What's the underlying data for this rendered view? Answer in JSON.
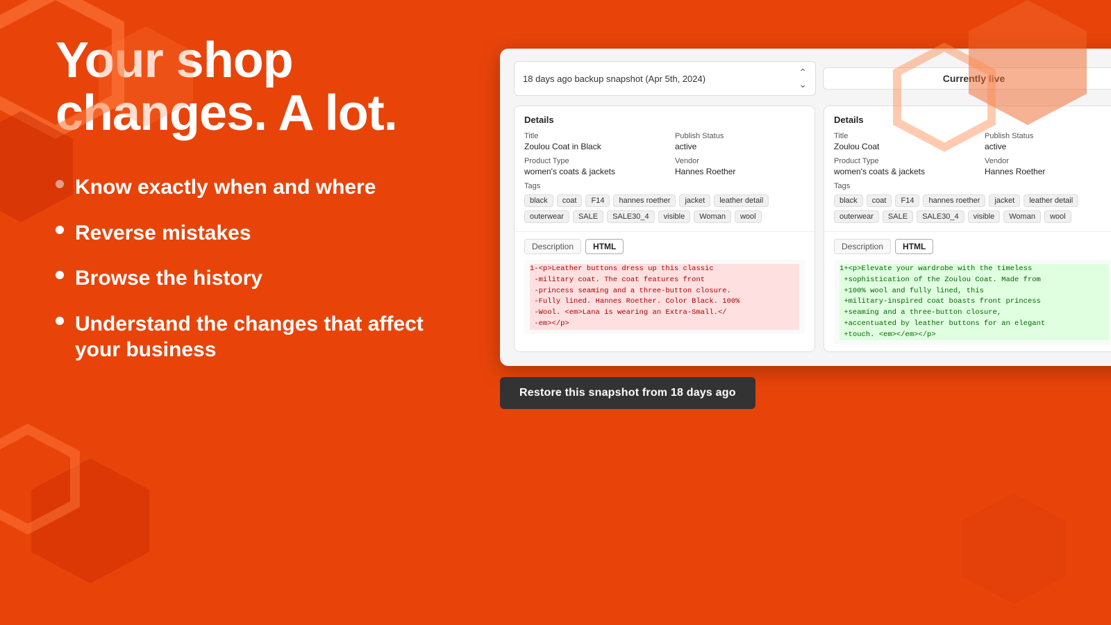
{
  "page": {
    "title": "Your shop changes. A lot.",
    "background_color": "#e8440a"
  },
  "bullets": [
    {
      "id": "bullet-1",
      "text": "Know exactly when and where"
    },
    {
      "id": "bullet-2",
      "text": "Reverse mistakes"
    },
    {
      "id": "bullet-3",
      "text": "Browse the history"
    },
    {
      "id": "bullet-4",
      "text": "Understand the changes that affect your business"
    }
  ],
  "panel": {
    "snapshot_label": "18 days ago backup snapshot (Apr 5th, 2024)",
    "live_label": "Currently live",
    "left": {
      "section_title": "Details",
      "title_label": "Title",
      "title_value": "Zoulou Coat in Black",
      "publish_status_label": "Publish Status",
      "publish_status_value": "active",
      "product_type_label": "Product Type",
      "product_type_value": "women's coats & jackets",
      "vendor_label": "Vendor",
      "vendor_value": "Hannes Roether",
      "tags_label": "Tags",
      "tags": [
        "black",
        "coat",
        "F14",
        "hannes roether",
        "jacket",
        "leather detail",
        "outerwear",
        "SALE",
        "SALE30_4",
        "visible",
        "Woman",
        "wool"
      ],
      "description_tab": "Description",
      "html_tab": "HTML",
      "active_tab": "HTML",
      "diff_lines": [
        {
          "type": "removed",
          "text": "1-<p>Leather buttons dress up this classic"
        },
        {
          "type": "removed",
          "text": " -military coat. The coat features front"
        },
        {
          "type": "removed",
          "text": " -princess seaming and a three-button closure."
        },
        {
          "type": "removed",
          "text": " -Fully lined. Hannes Roether. Color Black. 100%"
        },
        {
          "type": "removed",
          "text": " -Wool. <em>Lana is wearing an Extra-Small.</"
        },
        {
          "type": "removed",
          "text": " -em></p>"
        }
      ]
    },
    "right": {
      "section_title": "Details",
      "title_label": "Title",
      "title_value": "Zoulou Coat",
      "publish_status_label": "Publish Status",
      "publish_status_value": "active",
      "product_type_label": "Product Type",
      "product_type_value": "women's coats & jackets",
      "vendor_label": "Vendor",
      "vendor_value": "Hannes Roether",
      "tags_label": "Tags",
      "tags": [
        "black",
        "coat",
        "F14",
        "hannes roether",
        "jacket",
        "leather detail",
        "outerwear",
        "SALE",
        "SALE30_4",
        "visible",
        "Woman",
        "wool"
      ],
      "description_tab": "Description",
      "html_tab": "HTML",
      "active_tab": "HTML",
      "diff_lines": [
        {
          "type": "added",
          "text": "1+<p>Elevate your wardrobe with the timeless"
        },
        {
          "type": "added",
          "text": " +sophistication of the Zoulou Coat. Made from"
        },
        {
          "type": "added",
          "text": " +100% wool and fully lined, this"
        },
        {
          "type": "added",
          "text": " +military-inspired coat boasts front princess"
        },
        {
          "type": "added",
          "text": " +seaming and a three-button closure,"
        },
        {
          "type": "added",
          "text": " +accentuated by leather buttons for an elegant"
        },
        {
          "type": "added",
          "text": " +touch. <em></em></p>"
        }
      ]
    },
    "restore_button": "Restore this snapshot from 18 days ago"
  }
}
